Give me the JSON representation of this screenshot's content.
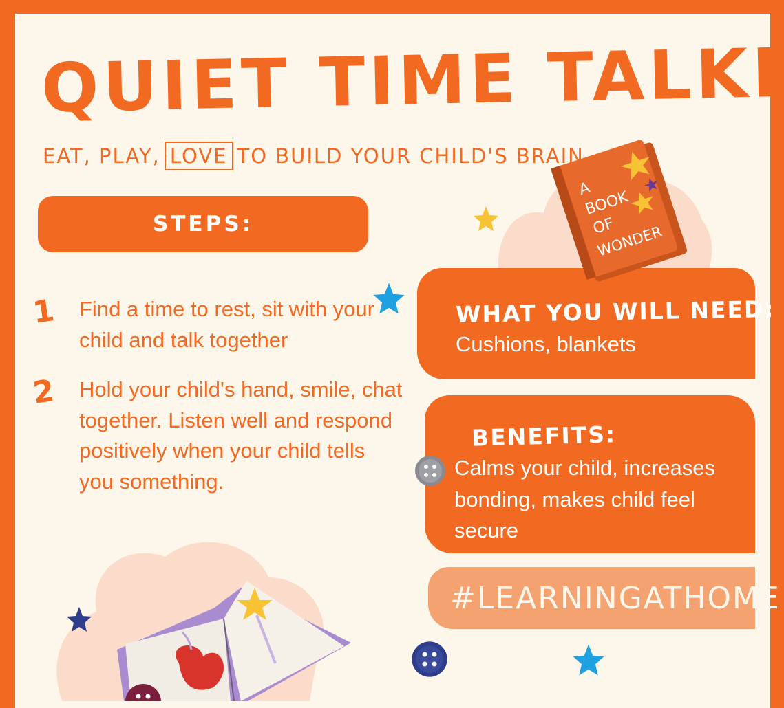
{
  "title": "QUIET TIME TALKING",
  "subtitle": {
    "before": "EAT, PLAY,",
    "boxed": "LOVE",
    "after": "TO BUILD YOUR CHILD'S BRAIN"
  },
  "steps_label": "STEPS:",
  "steps": [
    {
      "number": "1",
      "text": "Find a time to rest, sit with your child and talk together"
    },
    {
      "number": "2",
      "text": "Hold your child's hand, smile, chat together. Listen well and respond positively when your child tells you something."
    }
  ],
  "need": {
    "heading": "WHAT YOU WILL NEED:",
    "text": "Cushions, blankets"
  },
  "benefits": {
    "heading": "BENEFITS:",
    "text": "Calms your child, increases bonding, makes child feel secure"
  },
  "hashtag": "#LEARNINGATHOME",
  "book_cover": {
    "line1": "A",
    "line2": "BOOK",
    "line3": "OF",
    "line4": "WONDER"
  },
  "colors": {
    "accent": "#f26a21",
    "background": "#fdf6ea",
    "hashtag_bg": "#f4a26f"
  }
}
